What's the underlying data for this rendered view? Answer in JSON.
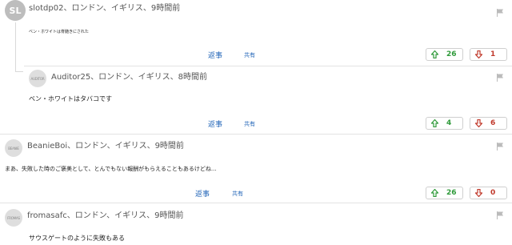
{
  "comments": [
    {
      "avatar_text": "SL",
      "meta": "slotdp02、ロンドン、イギリス、9時間前",
      "text": "ベン・ホワイトは脊髄きにされた",
      "reply_label": "返事",
      "share_label": "共有",
      "up": "26",
      "down": "1"
    },
    {
      "avatar_text": "AUDITOR",
      "meta": "Auditor25、ロンドン、イギリス、8時間前",
      "text": "ベン・ホワイトはタバコです",
      "reply_label": "返事",
      "share_label": "共有",
      "up": "4",
      "down": "6"
    },
    {
      "avatar_text": "BEANIE",
      "meta": "BeanieBoi、ロンドン、イギリス、9時間前",
      "text": "まあ、失敗した時のご褒美として、とんでもない報酬がもらえることもあるけどね...",
      "reply_label": "返事",
      "share_label": "共有",
      "up": "26",
      "down": "0"
    },
    {
      "avatar_text": "FROMAS",
      "meta": "fromasafc、ロンドン、イギリス、9時間前",
      "text": "サウスゲートのように失敗もある"
    }
  ],
  "icons": {
    "upvote": "arrow-up-icon",
    "downvote": "arrow-down-icon",
    "report": "flag-icon"
  },
  "colors": {
    "link": "#2366b8",
    "upvote": "#2f9a3a",
    "downvote": "#c0392b"
  }
}
